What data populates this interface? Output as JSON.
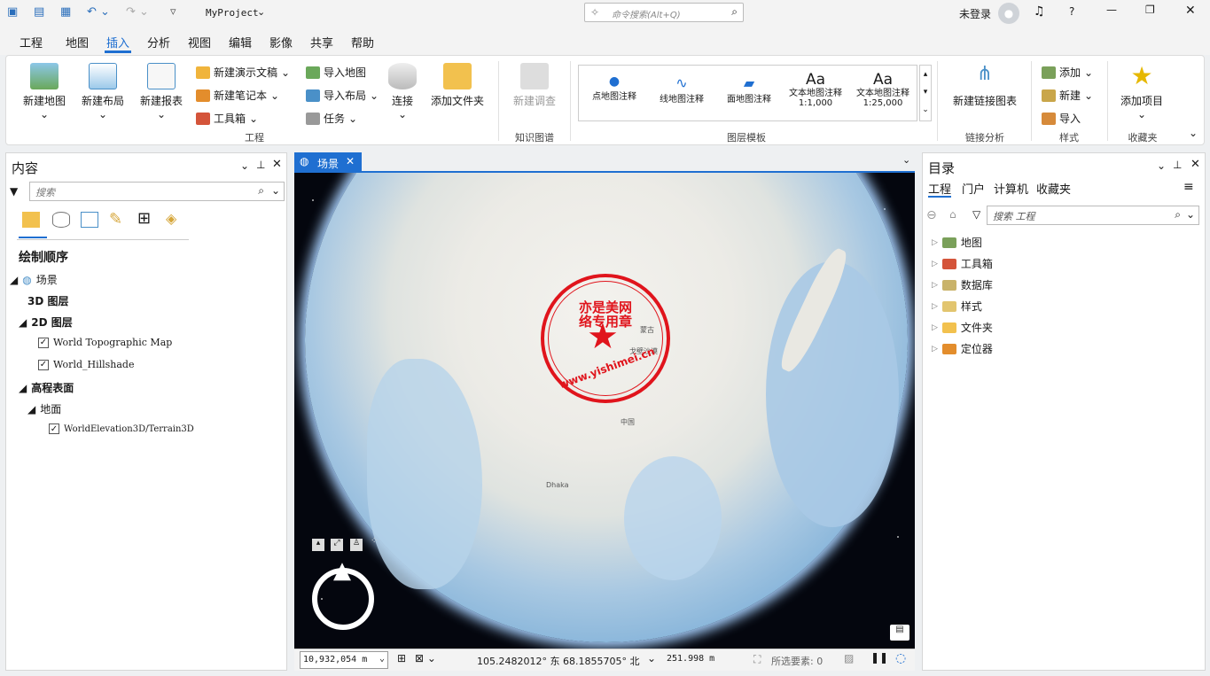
{
  "titlebar": {
    "project": "MyProject",
    "command_search_placeholder": "命令搜索(Alt+Q)",
    "user": "未登录"
  },
  "menu_tabs": [
    "工程",
    "地图",
    "插入",
    "分析",
    "视图",
    "编辑",
    "影像",
    "共享",
    "帮助"
  ],
  "active_tab": "插入",
  "ribbon": {
    "new_map": "新建地图",
    "new_layout": "新建布局",
    "new_report": "新建报表",
    "new_presentation": "新建演示文稿",
    "new_notebook": "新建笔记本",
    "toolbox": "工具箱",
    "import_map": "导入地图",
    "import_layout": "导入布局",
    "task": "任务",
    "connect": "连接",
    "add_folder": "添加文件夹",
    "group_project": "工程",
    "new_survey": "新建调查",
    "group_knowledge": "知识图谱",
    "templates": [
      "点地图注释",
      "线地图注释",
      "面地图注释",
      "文本地图注释\n1:1,000",
      "文本地图注释\n1:25,000"
    ],
    "group_layer_templates": "图层模板",
    "new_link_chart": "新建链接图表",
    "group_link_analysis": "链接分析",
    "add": "添加",
    "new": "新建",
    "import": "导入",
    "group_styles": "样式",
    "add_item": "添加项目",
    "group_favorites": "收藏夹"
  },
  "contents": {
    "title": "内容",
    "search_placeholder": "搜索",
    "draw_order": "绘制顺序",
    "scene": "场景",
    "layers3d": "3D 图层",
    "layers2d": "2D 图层",
    "layer1": "World Topographic Map",
    "layer2": "World_Hillshade",
    "elevation": "高程表面",
    "ground": "地面",
    "terrain": "WorldElevation3D/Terrain3D"
  },
  "view_tab": "场景",
  "map_labels": {
    "stamp_text": "亦是美网络专用章",
    "stamp_url": "www.yishimei.cn",
    "l1": "蒙古",
    "l2": "戈壁沙漠",
    "l3": "中国",
    "l4": "Dhaka"
  },
  "status": {
    "scale": "10,932,054 m",
    "coords": "105.2482012° 东 68.1855705° 北",
    "elev": "251.998 m",
    "selected": "所选要素: 0"
  },
  "catalog": {
    "title": "目录",
    "tabs": [
      "工程",
      "门户",
      "计算机",
      "收藏夹"
    ],
    "search_placeholder": "搜索 工程",
    "items": [
      "地图",
      "工具箱",
      "数据库",
      "样式",
      "文件夹",
      "定位器"
    ]
  },
  "colors": {
    "accent": "#1f6fd1",
    "stamp": "#e0141c"
  }
}
